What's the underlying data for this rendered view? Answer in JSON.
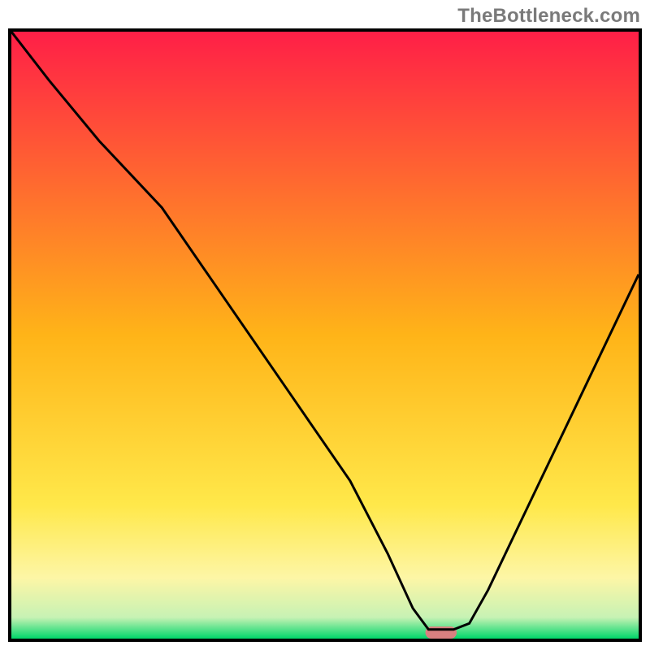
{
  "watermark": "TheBottleneck.com",
  "chart_data": {
    "type": "line",
    "title": "",
    "xlabel": "",
    "ylabel": "",
    "xlim": [
      0,
      100
    ],
    "ylim": [
      0,
      100
    ],
    "grid": false,
    "legend": false,
    "background_gradient": {
      "stops": [
        {
          "t": 0.0,
          "color": "#ff1f47"
        },
        {
          "t": 0.5,
          "color": "#ffb418"
        },
        {
          "t": 0.78,
          "color": "#ffe84a"
        },
        {
          "t": 0.9,
          "color": "#fdf6a6"
        },
        {
          "t": 0.965,
          "color": "#c7f2b4"
        },
        {
          "t": 1.0,
          "color": "#00d66a"
        }
      ]
    },
    "series": [
      {
        "name": "bottleneck-curve",
        "color": "#000000",
        "x": [
          0.0,
          6.0,
          14.0,
          24.0,
          34.0,
          44.0,
          54.0,
          60.0,
          64.0,
          66.5,
          70.5,
          73.0,
          76.0,
          82.0,
          88.0,
          94.0,
          100.0
        ],
        "y": [
          100.0,
          92.0,
          82.0,
          71.0,
          56.0,
          41.0,
          26.0,
          14.0,
          5.0,
          1.5,
          1.5,
          2.5,
          8.0,
          21.0,
          34.0,
          47.0,
          60.0
        ]
      }
    ],
    "marker": {
      "name": "sweet-spot",
      "shape": "rounded-rect",
      "color": "#d98080",
      "x": 68.5,
      "y": 1.0,
      "w": 5.0,
      "h": 2.0
    }
  }
}
